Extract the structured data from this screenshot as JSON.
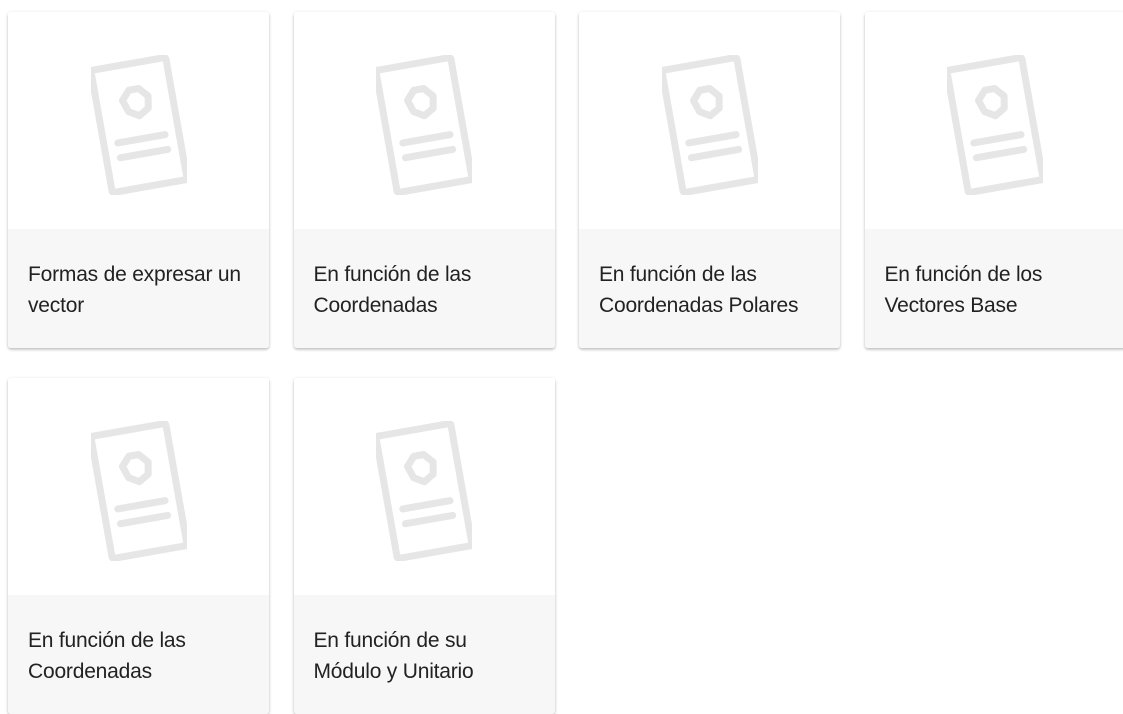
{
  "cards": [
    {
      "title": "Formas de expresar un vector",
      "thumbnail_icon": "placeholder-document-icon"
    },
    {
      "title": "En función de las Coordenadas",
      "thumbnail_icon": "placeholder-document-icon"
    },
    {
      "title": "En función de las Coordenadas Polares",
      "thumbnail_icon": "placeholder-document-icon"
    },
    {
      "title": "En función de los Vectores Base",
      "thumbnail_icon": "placeholder-document-icon"
    },
    {
      "title": "En función de las Coordenadas",
      "thumbnail_icon": "placeholder-document-icon"
    },
    {
      "title": "En función de su Módulo y Unitario",
      "thumbnail_icon": "placeholder-document-icon"
    }
  ],
  "colors": {
    "card_background": "#ffffff",
    "footer_background": "#f7f7f7",
    "title_text": "#222222",
    "placeholder_icon": "#e6e6e6"
  }
}
